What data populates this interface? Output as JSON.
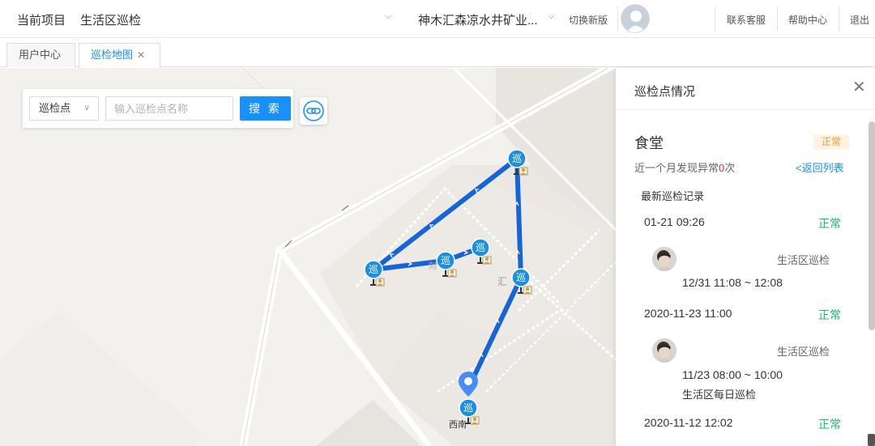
{
  "header": {
    "project_label": "当前项目",
    "project_name": "生活区巡检",
    "org_name": "神木汇森凉水井矿业...",
    "switch_label": "切换新版",
    "links": [
      "联系客服",
      "帮助中心",
      "退出"
    ]
  },
  "tabs": [
    {
      "label": "用户中心",
      "active": false
    },
    {
      "label": "巡检地图",
      "active": true,
      "closable": true
    }
  ],
  "search": {
    "type_selected": "巡检点",
    "placeholder": "输入巡检点名称",
    "button_label": "搜 索"
  },
  "map": {
    "checkpoint_glyph": "巡",
    "label_southwest": "西南",
    "label_hui": "汇",
    "label_ke": "刻",
    "route_color": "#1565d8"
  },
  "panel": {
    "title": "巡检点情况",
    "point_name": "食堂",
    "status_badge": "正常",
    "month_prefix": "近一个月发现异常",
    "month_count": "0",
    "month_suffix": "次",
    "back_label": "<返回列表",
    "latest_label": "最新巡检记录",
    "records": [
      {
        "time": "01-21 09:26",
        "status": "正常",
        "area": "生活区巡检",
        "range": "12/31   11:08 ~ 12:08",
        "plan": ""
      },
      {
        "time": "2020-11-23 11:00",
        "status": "正常",
        "area": "生活区巡检",
        "range": "11/23   08:00 ~ 10:00",
        "plan": "生活区每日巡检"
      },
      {
        "time": "2020-11-12 12:02",
        "status": "正常",
        "area": "",
        "range": "",
        "plan": ""
      }
    ]
  }
}
